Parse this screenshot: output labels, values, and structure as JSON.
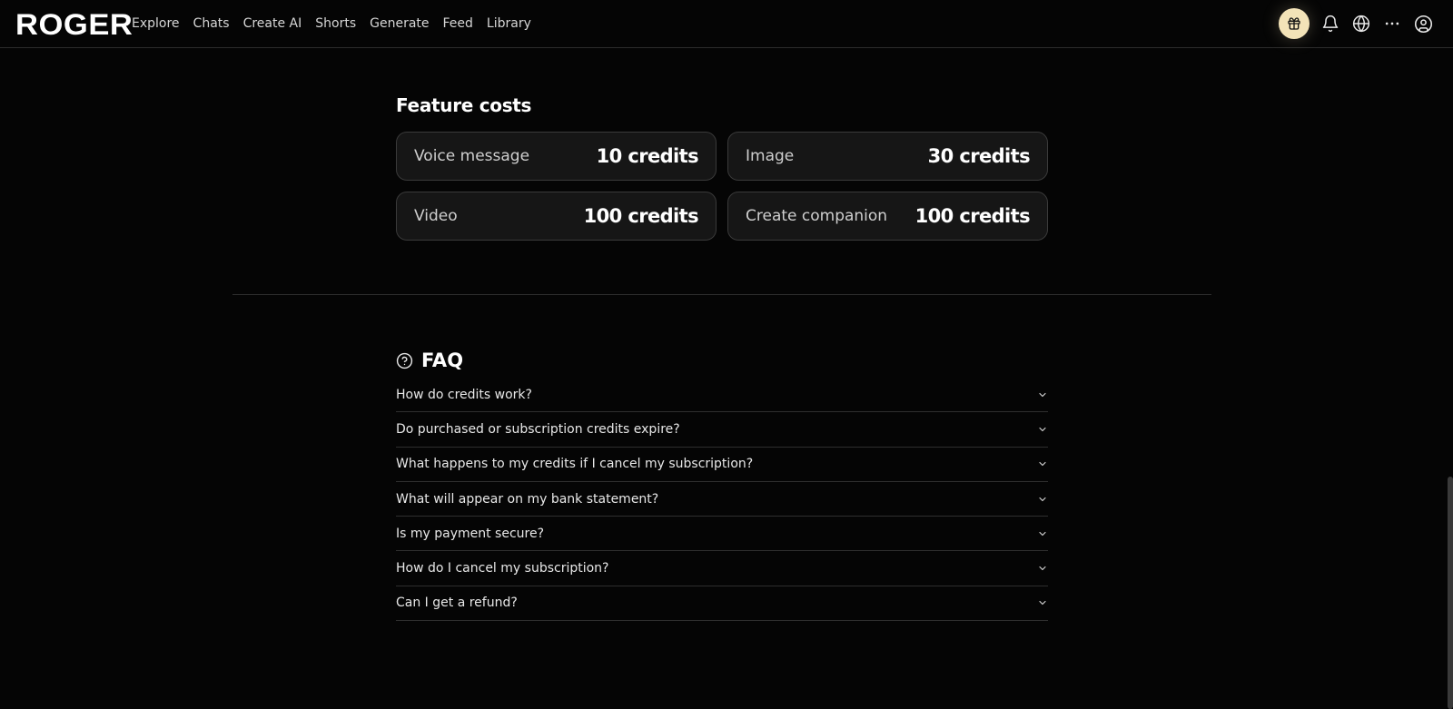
{
  "brand": {
    "logo": "ROGER"
  },
  "nav": [
    "Explore",
    "Chats",
    "Create AI",
    "Shorts",
    "Generate",
    "Feed",
    "Library"
  ],
  "header_icons": [
    "gift-icon",
    "bell-icon",
    "globe-icon",
    "more-icon",
    "user-icon"
  ],
  "feature_costs": {
    "title": "Feature costs",
    "items": [
      {
        "label": "Voice message",
        "value": "10 credits"
      },
      {
        "label": "Image",
        "value": "30 credits"
      },
      {
        "label": "Video",
        "value": "100 credits"
      },
      {
        "label": "Create companion",
        "value": "100 credits"
      }
    ]
  },
  "faq": {
    "title": "FAQ",
    "items": [
      "How do credits work?",
      "Do purchased or subscription credits expire?",
      "What happens to my credits if I cancel my subscription?",
      "What will appear on my bank statement?",
      "Is my payment secure?",
      "How do I cancel my subscription?",
      "Can I get a refund?"
    ]
  },
  "colors": {
    "background": "#050505",
    "accent_gift": "#f3e3b8",
    "card_bg": "#161616",
    "card_border": "#3a3a3a"
  }
}
